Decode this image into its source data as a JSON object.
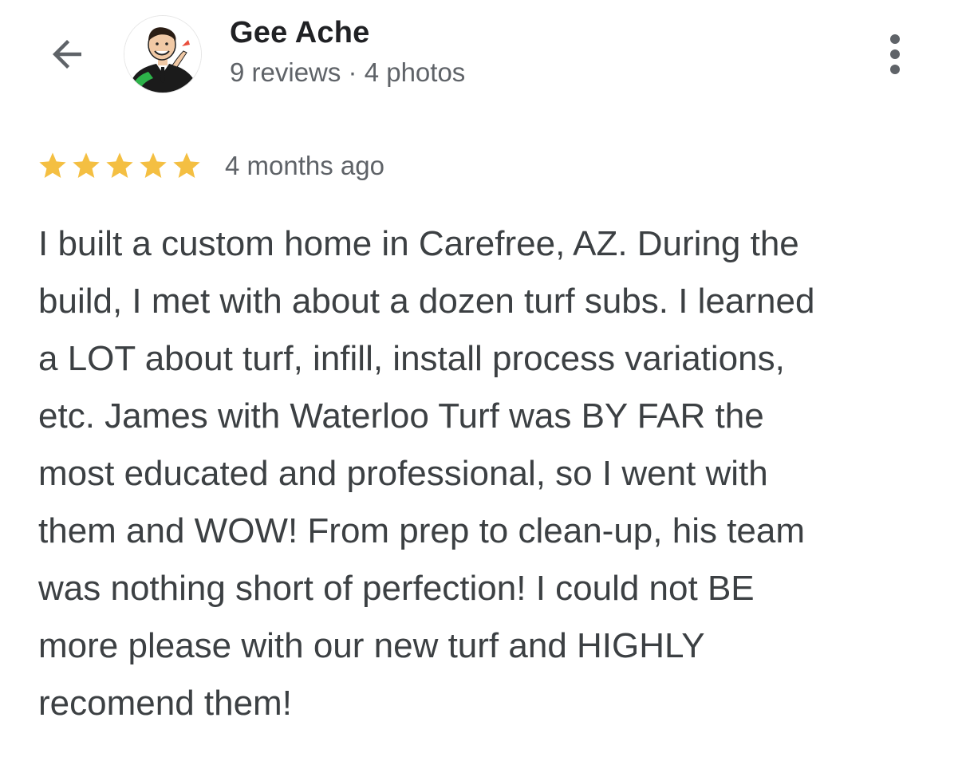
{
  "header": {
    "back_icon": "arrow-back-icon",
    "reviewer_name": "Gee Ache",
    "reviewer_meta": "9 reviews · 4 photos",
    "more_icon": "more-vert-icon"
  },
  "review": {
    "rating": 5,
    "rating_max": 5,
    "star_color": "#f4bf42",
    "time_ago": "4 months ago",
    "text_lines": [
      "I built a custom home in Carefree, AZ. During the",
      "build, I met with about a dozen turf subs. I learned",
      "a LOT about turf, infill, install process variations,",
      "etc. James with Waterloo Turf was BY FAR the",
      "most educated and professional, so I went with",
      "them and WOW! From prep to clean-up, his team",
      "was nothing short of perfection! I could not BE",
      "more please with our new turf and HIGHLY",
      "recomend them!"
    ]
  }
}
